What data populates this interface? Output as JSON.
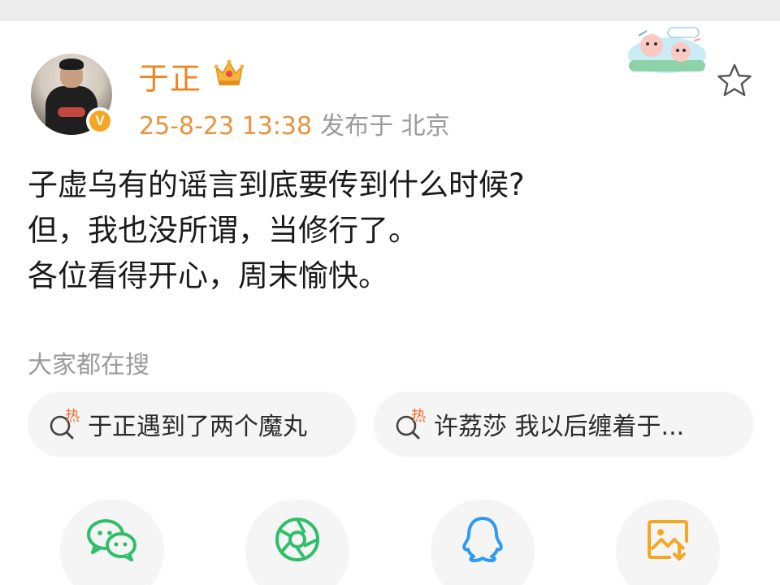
{
  "post": {
    "author": {
      "name": "于正",
      "avatar_icon": "user-avatar-photo",
      "verified_icon": "verified-v-badge",
      "verified_letter": "V",
      "member_icon": "crown-icon",
      "name_color": "#f2841f"
    },
    "time": "25-8-23 13:38",
    "location": "发布于 北京",
    "favorite_icon": "star-outline-icon",
    "body_lines": [
      "子虚乌有的谣言到底要传到什么时候?",
      "但，我也没所谓，当修行了。",
      "各位看得开心，周末愉快。"
    ]
  },
  "trending": {
    "title": "大家都在搜",
    "items": [
      {
        "icon": "hot-search-icon",
        "badge": "热",
        "label": "于正遇到了两个魔丸"
      },
      {
        "icon": "hot-search-icon",
        "badge": "热",
        "label": "许荔莎 我以后缠着于..."
      }
    ]
  },
  "share": [
    {
      "icon": "wechat-icon",
      "color": "#2dbf6a"
    },
    {
      "icon": "moments-icon",
      "color": "#2dbf6a"
    },
    {
      "icon": "qq-icon",
      "color": "#2e9bf0"
    },
    {
      "icon": "save-image-icon",
      "color": "#f5a623"
    }
  ],
  "colors": {
    "accent": "#f2841f",
    "time": "#e8933c",
    "secondary_text": "#9b9b9b",
    "chip_bg": "#f5f5f5"
  }
}
